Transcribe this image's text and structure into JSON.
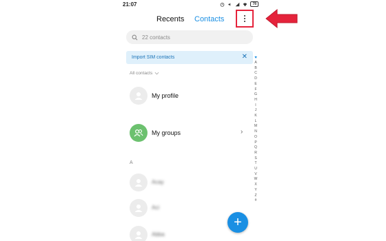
{
  "status_bar": {
    "time": "21:07",
    "battery": "78"
  },
  "header": {
    "tab_recents": "Recents",
    "tab_contacts": "Contacts"
  },
  "search": {
    "placeholder": "22 contacts"
  },
  "import_bar": {
    "label": "Import SIM contacts",
    "close": "✕"
  },
  "filter": {
    "label": "All contacts"
  },
  "rows": {
    "my_profile": "My profile",
    "my_groups": "My groups"
  },
  "section_a": "A",
  "contacts": [
    {
      "name": "Acay"
    },
    {
      "name": "Aci"
    },
    {
      "name": "Abba"
    }
  ],
  "alphabet": [
    "A",
    "B",
    "C",
    "D",
    "E",
    "F",
    "G",
    "H",
    "I",
    "J",
    "K",
    "L",
    "M",
    "N",
    "O",
    "P",
    "Q",
    "R",
    "S",
    "T",
    "U",
    "V",
    "W",
    "X",
    "Y",
    "Z",
    "#"
  ],
  "fab": {
    "label": "+"
  },
  "colors": {
    "accent": "#1a8fe3",
    "highlight": "#e5233b",
    "group_avatar": "#6cc16f"
  },
  "icons": {
    "menu": "more-vert-icon",
    "search": "search-icon",
    "close": "close-icon",
    "arrow": "arrow-pointer-icon"
  }
}
